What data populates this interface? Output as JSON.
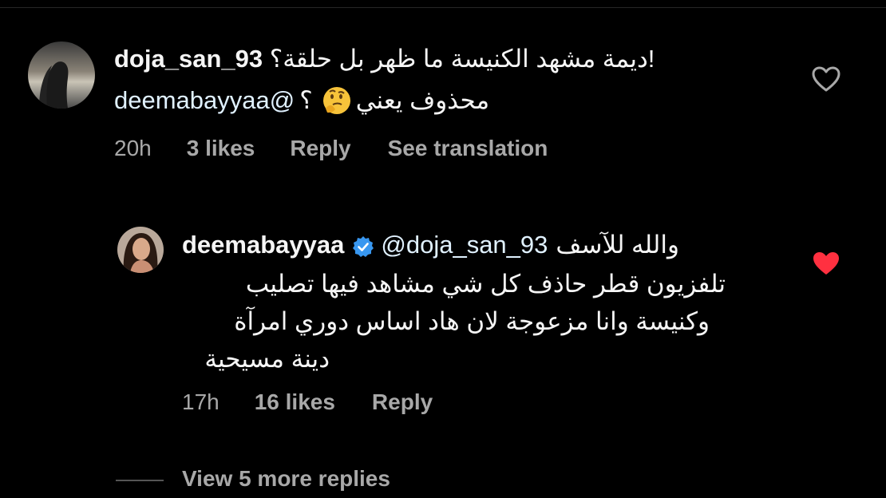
{
  "comment": {
    "username": "doja_san_93",
    "text_line1": "!ديمة مشهد الكنيسة ما ظهر بل حلقة؟",
    "mention": "deemabayyaa@",
    "text_line2_question": "؟",
    "text_line2_rest": "محذوف يعني",
    "emoji": "thinking-face",
    "time": "20h",
    "likes": "3 likes",
    "reply_label": "Reply",
    "translate_label": "See translation",
    "liked": false
  },
  "reply": {
    "username": "deemabayyaa",
    "verified": true,
    "mention": "@doja_san_93",
    "text_line1": "والله للآسف",
    "text_line2": "تلفزيون قطر حاذف كل شي مشاهد فيها تصليب",
    "text_line3": "وكنيسة وانا مزعوجة لان هاد اساس دوري امرآة",
    "text_line4": "دينة مسيحية",
    "time": "17h",
    "likes": "16 likes",
    "reply_label": "Reply",
    "liked": true
  },
  "view_more_label": "View 5 more replies",
  "colors": {
    "background": "#000000",
    "text": "#f5f5f5",
    "meta": "#a8a8a8",
    "mention": "#e0f1ff",
    "like_red": "#ff3040",
    "verified_blue": "#3897f0"
  }
}
